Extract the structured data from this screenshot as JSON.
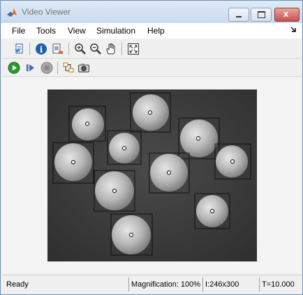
{
  "window": {
    "title": "Video Viewer"
  },
  "menu": [
    "File",
    "Tools",
    "View",
    "Simulation",
    "Help"
  ],
  "toolbar1": [
    "print-icon",
    "info-icon",
    "export-icon",
    "zoom-in-icon",
    "zoom-out-icon",
    "pan-hand-icon",
    "fit-to-window-icon"
  ],
  "toolbar2": [
    "play-icon",
    "step-forward-icon",
    "stop-icon",
    "highlight-model-icon",
    "snapshot-camera-icon"
  ],
  "colors": {
    "play": "#2e9a2e",
    "info": "#1f5fa8",
    "stop": "#8a8a8a"
  },
  "status": {
    "state": "Ready",
    "magnification": "Magnification: 100%",
    "size": "I:246x300",
    "time": "T=10.000"
  }
}
